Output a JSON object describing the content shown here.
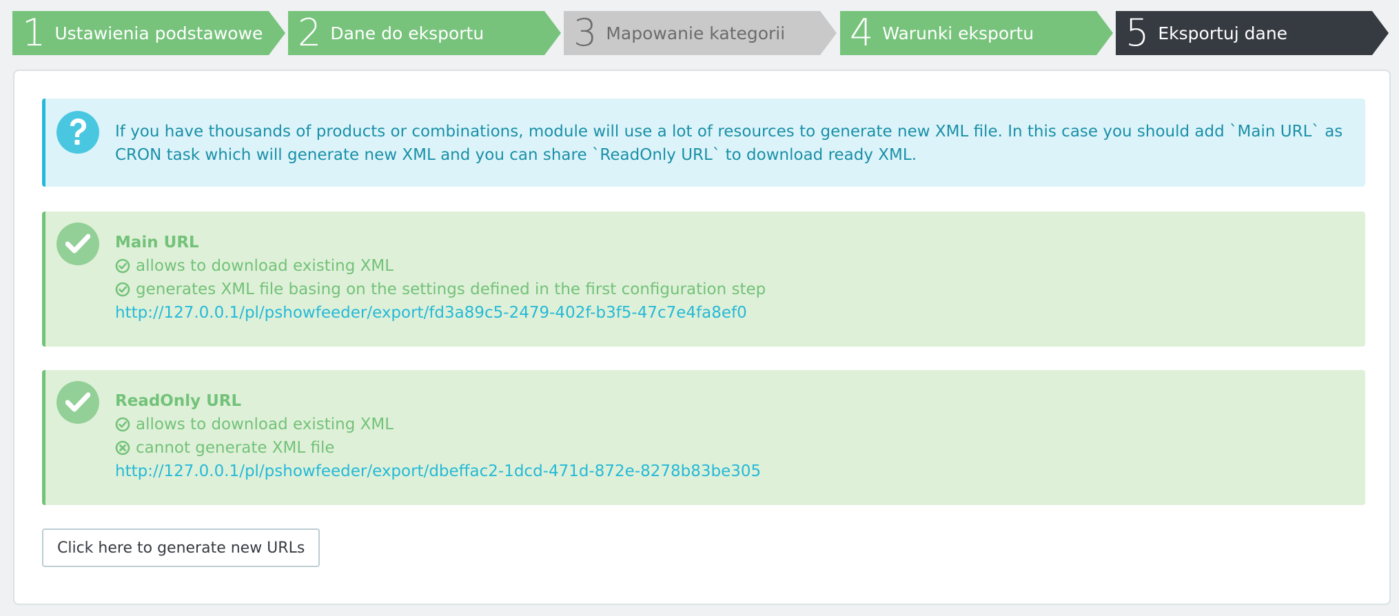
{
  "steps": [
    {
      "number": "1",
      "label": "Ustawienia podstawowe"
    },
    {
      "number": "2",
      "label": "Dane do eksportu"
    },
    {
      "number": "3",
      "label": "Mapowanie kategorii"
    },
    {
      "number": "4",
      "label": "Warunki eksportu"
    },
    {
      "number": "5",
      "label": "Eksportuj dane"
    }
  ],
  "info": {
    "icon": "question-circle-icon",
    "text": "If you have thousands of products or combinations, module will use a lot of resources to generate new XML file. In this case you should add `Main URL` as CRON task which will generate new XML and you can share `ReadOnly URL` to download ready XML."
  },
  "main_url": {
    "icon": "check-circle-icon",
    "title": "Main URL",
    "features": [
      {
        "icon": "check-circle-outline-icon",
        "text": "allows to download existing XML"
      },
      {
        "icon": "check-circle-outline-icon",
        "text": "generates XML file basing on the settings defined in the first configuration step"
      }
    ],
    "url": "http://127.0.0.1/pl/pshowfeeder/export/fd3a89c5-2479-402f-b3f5-47c7e4fa8ef0"
  },
  "readonly_url": {
    "icon": "check-circle-icon",
    "title": "ReadOnly URL",
    "features": [
      {
        "icon": "check-circle-outline-icon",
        "text": "allows to download existing XML"
      },
      {
        "icon": "times-circle-icon",
        "text": "cannot generate XML file"
      }
    ],
    "url": "http://127.0.0.1/pl/pshowfeeder/export/dbeffac2-1dcd-471d-872e-8278b83be305"
  },
  "generate_button_label": "Click here to generate new URLs",
  "colors": {
    "step_done": "#77c37c",
    "step_disabled": "#c9c9c9",
    "step_active": "#363a41",
    "info_bg": "#dcf4f9",
    "info_text": "#1a8fa8",
    "success_bg": "#dff0d8",
    "success_text": "#72c279",
    "link": "#25b9d7"
  }
}
